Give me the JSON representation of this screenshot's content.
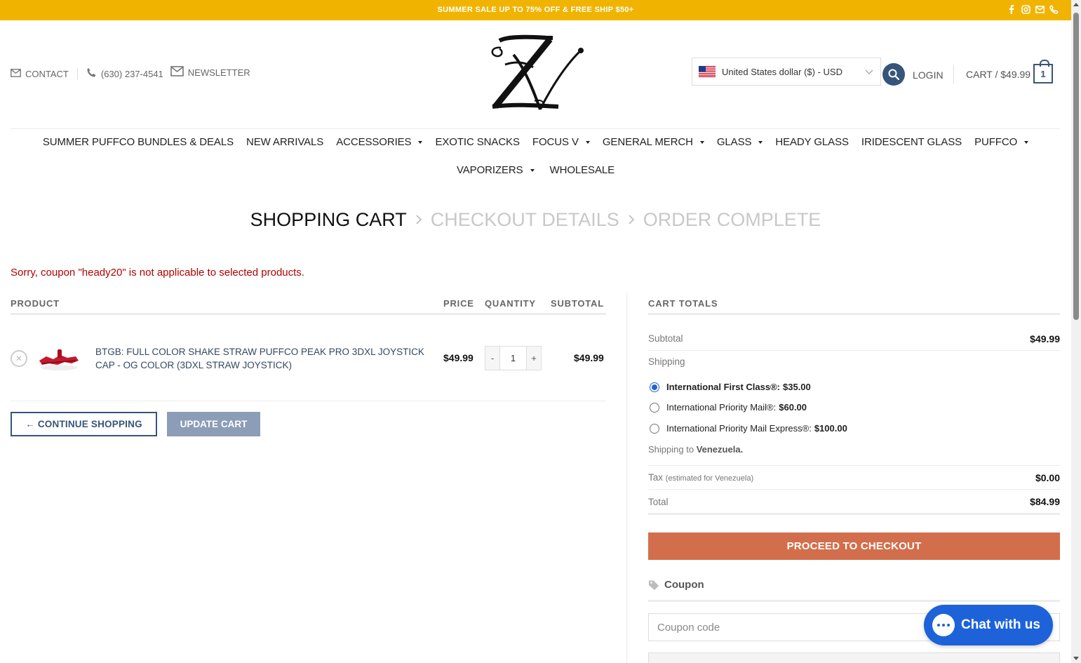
{
  "topbar": {
    "promo": "SUMMER SALE UP TO 75% OFF & FREE SHIP $50+",
    "social_icons": [
      "facebook-icon",
      "instagram-icon",
      "email-icon",
      "phone-icon"
    ],
    "bg_color": "#f0b400"
  },
  "header": {
    "contact_label": "CONTACT",
    "phone": "(630) 237-4541",
    "newsletter_label": "NEWSLETTER",
    "currency_selected": "United States dollar ($) - USD",
    "login_label": "LOGIN",
    "cart_label": "CART / $49.99",
    "cart_count": "1"
  },
  "nav": {
    "row1": [
      {
        "label": "SUMMER PUFFCO BUNDLES & DEALS",
        "dropdown": false
      },
      {
        "label": "NEW ARRIVALS",
        "dropdown": false
      },
      {
        "label": "ACCESSORIES",
        "dropdown": true
      },
      {
        "label": "EXOTIC SNACKS",
        "dropdown": false
      },
      {
        "label": "FOCUS V",
        "dropdown": true
      },
      {
        "label": "GENERAL MERCH",
        "dropdown": true
      },
      {
        "label": "GLASS",
        "dropdown": true
      },
      {
        "label": "HEADY GLASS",
        "dropdown": false
      },
      {
        "label": "IRIDESCENT GLASS",
        "dropdown": false
      },
      {
        "label": "PUFFCO",
        "dropdown": true
      }
    ],
    "row2": [
      {
        "label": "VAPORIZERS",
        "dropdown": true
      },
      {
        "label": "WHOLESALE",
        "dropdown": false
      }
    ]
  },
  "steps": {
    "current": "SHOPPING CART",
    "next": "CHECKOUT DETAILS",
    "last": "ORDER COMPLETE"
  },
  "error_message": "Sorry, coupon \"heady20\" is not applicable to selected products.",
  "cart_table": {
    "headers": {
      "product": "PRODUCT",
      "price": "PRICE",
      "quantity": "QUANTITY",
      "subtotal": "SUBTOTAL"
    },
    "item": {
      "name": "BTGB: Full Color Shake Straw Puffco Peak Pro 3DXL Joystick Cap - OG Color (3DXL Straw Joystick)",
      "price": "$49.99",
      "quantity": "1",
      "subtotal": "$49.99",
      "minus": "-",
      "plus": "+"
    },
    "continue_label": "← CONTINUE SHOPPING",
    "update_label": "UPDATE CART"
  },
  "totals": {
    "title": "CART TOTALS",
    "subtotal_label": "Subtotal",
    "subtotal_value": "$49.99",
    "shipping_label": "Shipping",
    "shipping_options": [
      {
        "name": "International First Class®:",
        "amount": "$35.00",
        "selected": true
      },
      {
        "name": "International Priority Mail®:",
        "amount": "$60.00",
        "selected": false
      },
      {
        "name": "International Priority Mail Express®:",
        "amount": "$100.00",
        "selected": false
      }
    ],
    "shipping_to_prefix": "Shipping to",
    "shipping_to_country": "Venezuela.",
    "tax_label": "Tax",
    "tax_note": "(estimated for Venezuela)",
    "tax_value": "$0.00",
    "total_label": "Total",
    "total_value": "$84.99",
    "checkout_label": "PROCEED TO CHECKOUT",
    "checkout_color": "#d26e4b",
    "coupon_heading": "Coupon",
    "coupon_placeholder": "Coupon code"
  },
  "chat": {
    "label": "Chat with us",
    "color": "#1d62d9"
  }
}
